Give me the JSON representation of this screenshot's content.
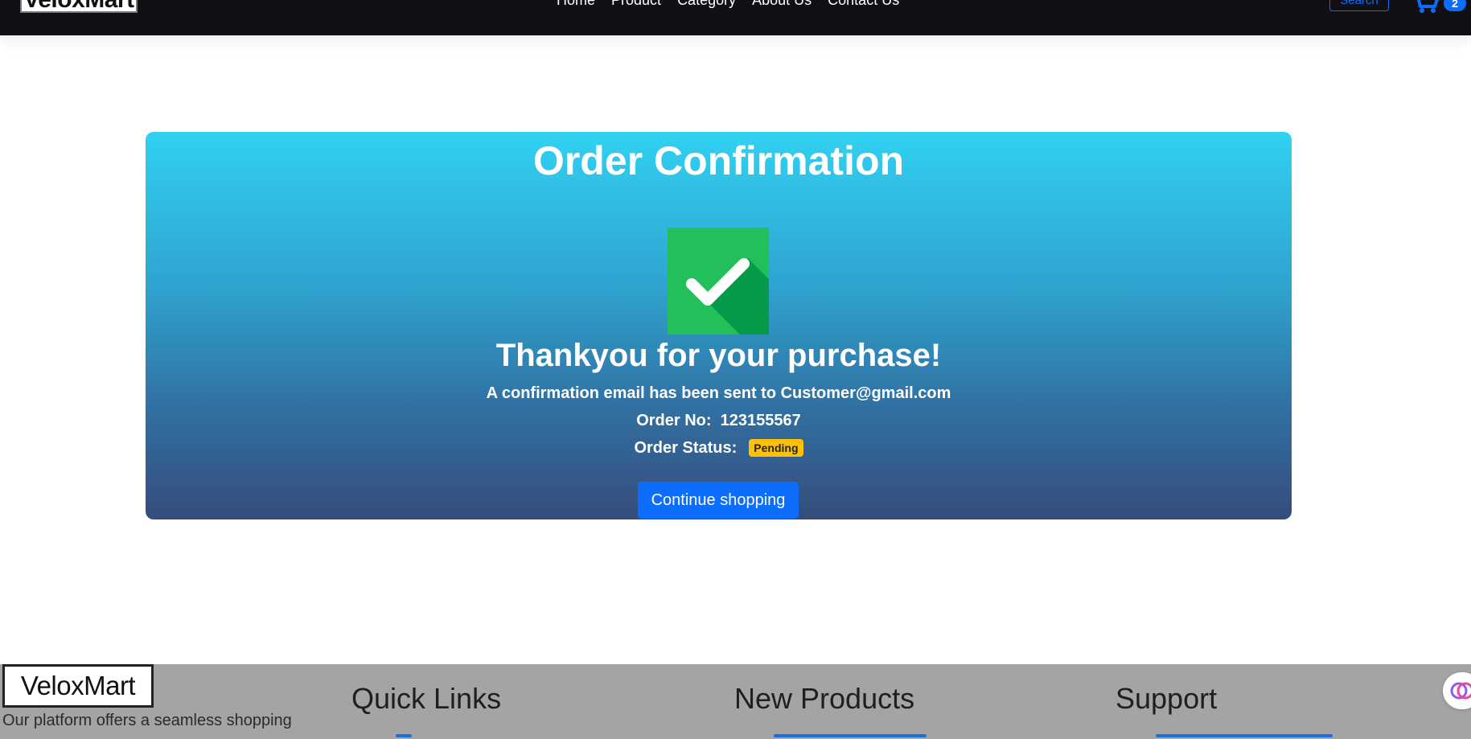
{
  "navbar": {
    "brand": "VeloxMart",
    "links": [
      "Home",
      "Product",
      "Category",
      "About Us",
      "Contact Us"
    ],
    "search_label": "Search",
    "cart_count": "2"
  },
  "confirmation": {
    "title": "Order Confirmation",
    "thank_you": "Thankyou for your purchase!",
    "email_prefix": "A confirmation email has been sent to",
    "email": "Customer@gmail.com",
    "order_no_label": "Order No:",
    "order_no": "123155567",
    "status_label": "Order Status:",
    "status_value": "Pending",
    "continue_label": "Continue shopping"
  },
  "footer": {
    "brand": "VeloxMart",
    "tagline": "Our platform offers a seamless shopping",
    "headings": [
      "Quick Links",
      "New Products",
      "Support"
    ]
  },
  "colors": {
    "navbar_bg": "#111014",
    "card_gradient_top": "#31d1f1",
    "card_gradient_bottom": "#354c7b",
    "primary": "#0d6efd",
    "warning_badge": "#ffc107",
    "success_green": "#22c05b",
    "footer_bg": "#a4a4a4"
  },
  "icons": {
    "check": "check-square-icon",
    "cart": "cart-icon",
    "chat": "ai-assistant-icon"
  }
}
